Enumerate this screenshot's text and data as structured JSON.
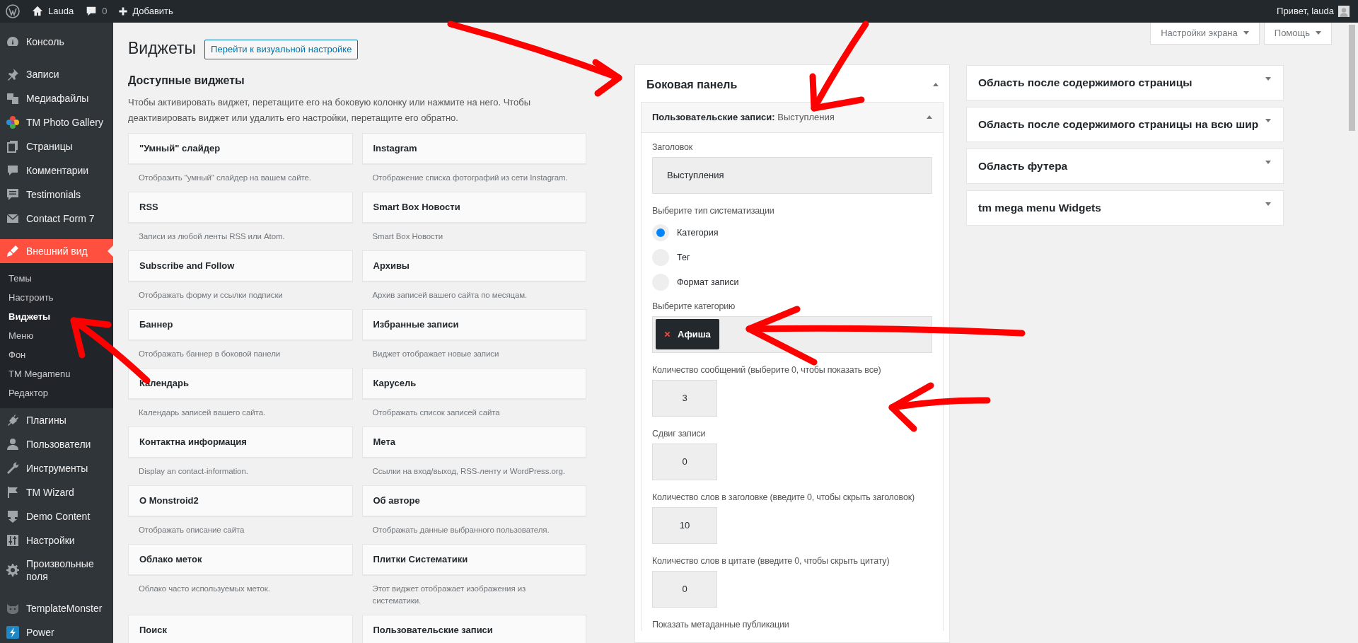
{
  "admin_bar": {
    "site": "Lauda",
    "comments": "0",
    "new": "Добавить",
    "greeting": "Привет, lauda"
  },
  "sidebar": {
    "groups": [
      {
        "items": [
          {
            "label": "Консоль",
            "selected": false
          }
        ]
      },
      {
        "items": [
          {
            "label": "Записи",
            "selected": false
          },
          {
            "label": "Медиафайлы",
            "selected": false
          },
          {
            "label": "TM Photo Gallery",
            "selected": false
          },
          {
            "label": "Страницы",
            "selected": false
          },
          {
            "label": "Комментарии",
            "selected": false
          },
          {
            "label": "Testimonials",
            "selected": false
          },
          {
            "label": "Contact Form 7",
            "selected": false
          }
        ]
      },
      {
        "items": [
          {
            "label": "Внешний вид",
            "selected": true,
            "children": [
              {
                "label": "Темы",
                "selected": false
              },
              {
                "label": "Настроить",
                "selected": false
              },
              {
                "label": "Виджеты",
                "selected": true
              },
              {
                "label": "Меню",
                "selected": false
              },
              {
                "label": "Фон",
                "selected": false
              },
              {
                "label": "TM Megamenu",
                "selected": false
              },
              {
                "label": "Редактор",
                "selected": false
              }
            ]
          },
          {
            "label": "Плагины",
            "selected": false
          },
          {
            "label": "Пользователи",
            "selected": false
          },
          {
            "label": "Инструменты",
            "selected": false
          },
          {
            "label": "TM Wizard",
            "selected": false
          },
          {
            "label": "Demo Content",
            "selected": false
          },
          {
            "label": "Настройки",
            "selected": false
          },
          {
            "label": "Произвольные поля",
            "selected": false
          }
        ]
      },
      {
        "items": [
          {
            "label": "TemplateMonster",
            "selected": false
          },
          {
            "label": "Power",
            "selected": false
          }
        ]
      }
    ]
  },
  "page": {
    "title": "Виджеты",
    "visual_button": "Перейти к визуальной настройке",
    "screen_buttons": [
      "Настройки экрана",
      "Помощь"
    ]
  },
  "available": {
    "heading": "Доступные виджеты",
    "description": "Чтобы активировать виджет, перетащите его на боковую колонку или нажмите на него. Чтобы деактивировать виджет или удалить его настройки, перетащите его обратно.",
    "widgets": [
      {
        "title": "\"Умный\" слайдер",
        "description": "Отобразить \"умный\" слайдер на вашем сайте."
      },
      {
        "title": "Instagram",
        "description": "Отображение списка фотографий из сети Instagram."
      },
      {
        "title": "RSS",
        "description": "Записи из любой ленты RSS или Atom."
      },
      {
        "title": "Smart Box Новости",
        "description": "Smart Box Новости"
      },
      {
        "title": "Subscribe and Follow",
        "description": "Отображать форму и ссылки подписки"
      },
      {
        "title": "Архивы",
        "description": "Архив записей вашего сайта по месяцам."
      },
      {
        "title": "Баннер",
        "description": "Отображать баннер в боковой панели"
      },
      {
        "title": "Избранные записи",
        "description": "Виджет отображает новые записи"
      },
      {
        "title": "Календарь",
        "description": "Календарь записей вашего сайта."
      },
      {
        "title": "Карусель",
        "description": "Отображать список записей сайта"
      },
      {
        "title": "Контактна информация",
        "description": "Display an contact-information."
      },
      {
        "title": "Мета",
        "description": "Ссылки на вход/выход, RSS-ленту и WordPress.org."
      },
      {
        "title": "О Monstroid2",
        "description": "Отображать описание сайта"
      },
      {
        "title": "Об авторе",
        "description": "Отображать данные выбранного пользователя."
      },
      {
        "title": "Облако меток",
        "description": "Облако часто используемых меток."
      },
      {
        "title": "Плитки Систематики",
        "description": "Этот виджет отображает изображения из систематики."
      },
      {
        "title": "Поиск"
      },
      {
        "title": "Пользовательские записи"
      }
    ]
  },
  "sidebar_area": {
    "title": "Боковая панель",
    "expanded": true,
    "widget": {
      "title": "**Пользовательские записи:** Выступления",
      "expanded": true,
      "fields": [
        {
          "kind": "text",
          "label": "Заголовок",
          "value": "Выступления"
        },
        {
          "kind": "radio",
          "label": "Выберите тип систематизации",
          "options": [
            {
              "label": "Категория",
              "selected": true
            },
            {
              "label": "Тег",
              "selected": false
            },
            {
              "label": "Формат записи",
              "selected": false
            }
          ]
        },
        {
          "kind": "tags",
          "label": "Выберите категорию",
          "tags": [
            "Афиша"
          ]
        },
        {
          "kind": "number",
          "label": "Количество сообщений (выберите 0, чтобы показать все)",
          "value": "3"
        },
        {
          "kind": "number",
          "label": "Сдвиг записи",
          "value": "0"
        },
        {
          "kind": "number",
          "label": "Количество слов в заголовке (введите 0, чтобы скрыть заголовок)",
          "value": "10"
        },
        {
          "kind": "number",
          "label": "Количество слов в цитате (введите 0, чтобы скрыть цитату)",
          "value": "0"
        },
        {
          "kind": "label",
          "label": "Показать метаданные публикации"
        }
      ]
    }
  },
  "areas": [
    {
      "title": "Область после содержимого страницы",
      "expanded": false
    },
    {
      "title": "Область после содержимого страницы на всю шир",
      "expanded": false
    },
    {
      "title": "Область футера",
      "expanded": false
    },
    {
      "title": "tm mega menu Widgets",
      "expanded": false
    }
  ]
}
